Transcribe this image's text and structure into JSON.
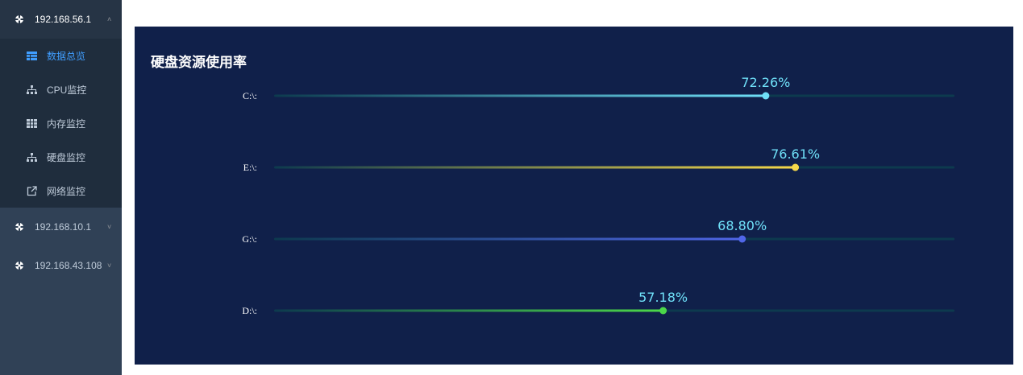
{
  "sidebar": {
    "nodes": [
      {
        "ip": "192.168.56.1",
        "expanded": true,
        "items": [
          {
            "label": "数据总览",
            "icon": "table-grid-icon",
            "active": true
          },
          {
            "label": "CPU监控",
            "icon": "sitemap-icon",
            "active": false
          },
          {
            "label": "内存监控",
            "icon": "table-icon",
            "active": false
          },
          {
            "label": "硬盘监控",
            "icon": "sitemap-icon",
            "active": false
          },
          {
            "label": "网络监控",
            "icon": "external-link-icon",
            "active": false
          }
        ]
      },
      {
        "ip": "192.168.10.1",
        "expanded": false
      },
      {
        "ip": "192.168.43.108",
        "expanded": false
      }
    ]
  },
  "panel": {
    "title": "硬盘资源使用率"
  },
  "chart_data": {
    "type": "bar",
    "orientation": "horizontal",
    "categories": [
      "C:\\:",
      "E:\\:",
      "G:\\:",
      "D:\\:"
    ],
    "values": [
      72.26,
      76.61,
      68.8,
      57.18
    ],
    "value_labels": [
      "72.26%",
      "76.61%",
      "68.80%",
      "57.18%"
    ],
    "xlim": [
      0,
      100
    ],
    "unit": "%",
    "colors": [
      "#6fe0f8",
      "#f5d84a",
      "#5066e8",
      "#4cd84a"
    ],
    "track_color": "#0d3a4e",
    "label_color": "#6fe0f8",
    "grid": false,
    "legend": "none"
  }
}
